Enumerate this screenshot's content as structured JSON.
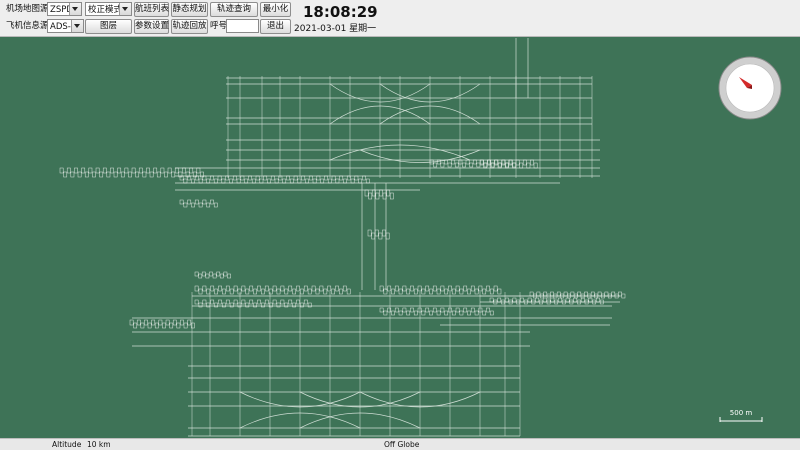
{
  "toolbar": {
    "airport_map_label": "机场地图源",
    "airport_map_value": "ZSPD",
    "aircraft_source_label": "飞机信息源",
    "aircraft_source_value": "ADS-B",
    "correction_mode": "校正模式",
    "layers": "图层",
    "flight_list": "航班列表",
    "params": "参数设置",
    "static_plan": "静态规划",
    "track_replay": "轨迹回放",
    "track_query": "轨迹查询",
    "callsign_label": "呼号",
    "callsign_value": "",
    "minimize": "最小化",
    "exit": "退出"
  },
  "clock": {
    "time": "18:08:29",
    "date": "2021-03-01  星期一"
  },
  "map": {
    "scale_label": "500 m",
    "background": "#3e7357",
    "line_color": "#e8f0ea",
    "compass_icon": "compass-icon",
    "compass_color": "#d42a2a"
  },
  "status": {
    "altitude_label": "Altitude",
    "altitude_value": "10 km",
    "globe_state": "Off Globe"
  }
}
